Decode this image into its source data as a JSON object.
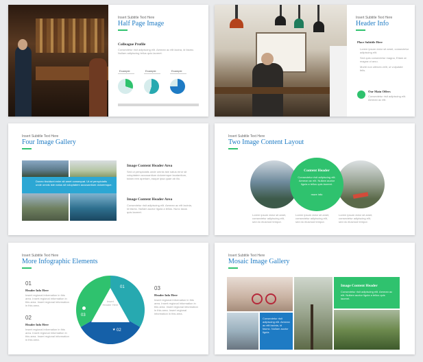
{
  "subtitle": "Insert Subtitle Text Here",
  "body_text": "Consectetur risit adipiscing elit. Aenean ac elit. Nullam auctor ligula a tellus.",
  "slide1": {
    "title": "Half Page Image",
    "profile_label": "Colleague Profile",
    "profile_text": "Consectetur risit adipiscing elit. Aenean ac elit lacina, id fasmc. Nullam adipiscing tellus quis laoreet.",
    "stats": [
      {
        "label": "Example",
        "value_pct": 30
      },
      {
        "label": "Example",
        "value_pct": 55
      },
      {
        "label": "Example",
        "value_pct": 75
      }
    ]
  },
  "slide2": {
    "title": "Header Info",
    "section_label": "Place Subtitle Here",
    "bullets": [
      "Lorem ipsum dolor sit amet, consectetur adipiscing elit.",
      "Sed quis consectetur magna, Etiam at magna ut arcu.",
      "Morbi non ultrices velit, ut vulputate felis."
    ],
    "offer_title": "Our Main Offers",
    "offer_text": "Consectetur risit adipiscing elit. Aenean ac elit."
  },
  "slide3": {
    "title": "Four Image Gallery",
    "overlay_text": "Donec tincidunt enim sit amet consequat. Ut at perspiciatis unde omnis iste natus sit voluptatem accusantium doloremque.",
    "header1": "Image Content Header Area",
    "header2": "Image Content Header Area",
    "text1": "Sed ut perspiciatis unde omnis iste natus error sit voluptatem accusantium doloremque laudantium, totam rem aperiam, eaque ipsa quae ab illo.",
    "text2": "Consectetur risit adipiscing elit. Aenean ac elit lacinia, id fasmc. Nullam auctor ligula a tellus. Nunc lacus quis laoreet."
  },
  "slide4": {
    "title": "Two Image Content Layout",
    "circle_title": "Content Header",
    "circle_text": "Consectetur risit adipiscing elit. Aenean ac elit. Nullam auctor ligula a tellus quis laoreet.",
    "circle_link": "more info",
    "cols": [
      "Lorem ipsum dolor sit amet, consectetur adipiscing elit, sed do eiusmod tempor.",
      "Lorem ipsum dolor sit amet, consectetur adipiscing elit, sed do eiusmod tempor.",
      "Lorem ipsum dolor sit amet, consectetur adipiscing elit, sed do eiusmod tempor."
    ]
  },
  "slide5": {
    "title": "More Infographic Elements",
    "items": [
      {
        "num": "01",
        "header": "Header Info Here",
        "text": "Insert regional information in this area. Insert regional information in this area. Insert regional information in this area."
      },
      {
        "num": "02",
        "header": "Header Info Here",
        "text": "Insert regional information in this area. Insert regional information in this area. Insert regional information in this area."
      },
      {
        "num": "03",
        "header": "Header Info Here",
        "text": "Insert regional information in this area. Insert regional information in this area. Insert regional information in this area. Insert regional information in this area."
      }
    ],
    "center_text": "Insert Header Here",
    "seg1": "01",
    "seg2": "02",
    "seg3": "03"
  },
  "slide6": {
    "title": "Mosaic Image Gallery",
    "header": "Image Content Header",
    "text": "Consectetur risit adipiscing elit. Aenean ac elit. Nullam auctor ligula a tellus quis laoreet.",
    "text2": "Consectetur risit adipiscing elit. Aenean ac elit lacinia, id fasmc. Nullam auctor ligula."
  },
  "colors": {
    "green": "#2fc26e",
    "blue": "#1e7bc4",
    "dark_blue": "#1560a8",
    "teal": "#27a9b0"
  }
}
